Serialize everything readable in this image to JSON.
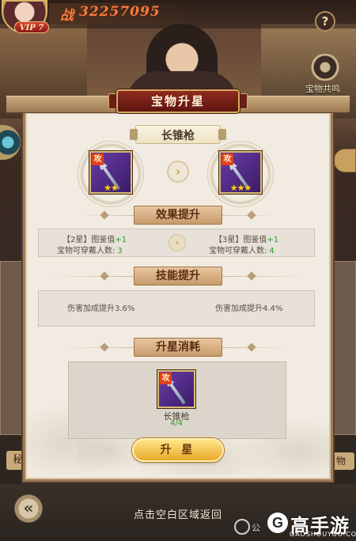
{
  "hud": {
    "vip": "VIP 7",
    "power_char": "战",
    "power_value": "32257095",
    "help": "?",
    "share_label": "宝物共鸣"
  },
  "background": {
    "left_button": "秘",
    "right_button": "物"
  },
  "modal": {
    "title": "宝物升星",
    "treasure_name": "长锥枪",
    "attack_tag": "攻",
    "current_stars": "★★",
    "next_stars": "★★★",
    "sections": {
      "effect": "效果提升",
      "skill": "技能提升",
      "cost": "升星消耗"
    },
    "effect": {
      "left_line1_prefix": "【2星】图鉴值",
      "left_line1_value": "+1",
      "left_line2_prefix": "宝物可穿戴人数:",
      "left_line2_value": "3",
      "right_line1_prefix": "【3星】图鉴值",
      "right_line1_value": "+1",
      "right_line2_prefix": "宝物可穿戴人数:",
      "right_line2_value": "4"
    },
    "skill": {
      "left": "伤害加成提升3.6%",
      "right": "伤害加成提升4.4%"
    },
    "cost": {
      "item_name": "长锥枪",
      "count": "4/4"
    },
    "upgrade_button": "升 星"
  },
  "footer": {
    "tap_back": "点击空白区域返回",
    "back_icon": "«"
  },
  "watermark": {
    "small": "公",
    "logo_letter": "G",
    "text": "高手游",
    "url": "GAOSHOUYOU.COM"
  }
}
